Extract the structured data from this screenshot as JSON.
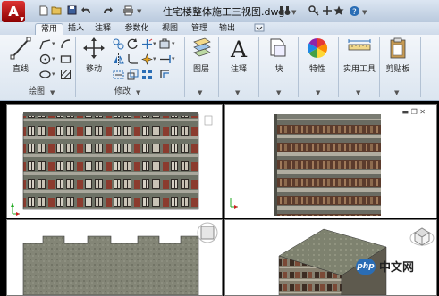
{
  "app": {
    "logo_letter": "A",
    "document_title": "住宅楼整体施工三视图.dwg",
    "quick_access": [
      "new-icon",
      "open-icon",
      "save-icon",
      "undo-icon",
      "redo-icon",
      "plot-icon"
    ],
    "right_tools": [
      "binoculars-icon",
      "key-icon",
      "star-icon",
      "help-icon"
    ]
  },
  "tabs": [
    {
      "label": "常用",
      "active": true
    },
    {
      "label": "插入",
      "active": false
    },
    {
      "label": "注释",
      "active": false
    },
    {
      "label": "参数化",
      "active": false
    },
    {
      "label": "视图",
      "active": false
    },
    {
      "label": "管理",
      "active": false
    },
    {
      "label": "输出",
      "active": false
    }
  ],
  "ribbon": {
    "panels": {
      "draw": "绘图",
      "modify": "修改"
    },
    "buttons": {
      "line": "直线",
      "move": "移动",
      "layers": "图层",
      "annotation": "注释",
      "block": "块",
      "properties": "特性",
      "utilities": "实用工具",
      "clipboard": "剪贴板"
    }
  },
  "watermark": {
    "badge": "php",
    "text": "中文网"
  },
  "colors": {
    "accent": "#2a6db5",
    "ribbon_bg": "#e6edf5",
    "logo_red": "#c62828"
  }
}
